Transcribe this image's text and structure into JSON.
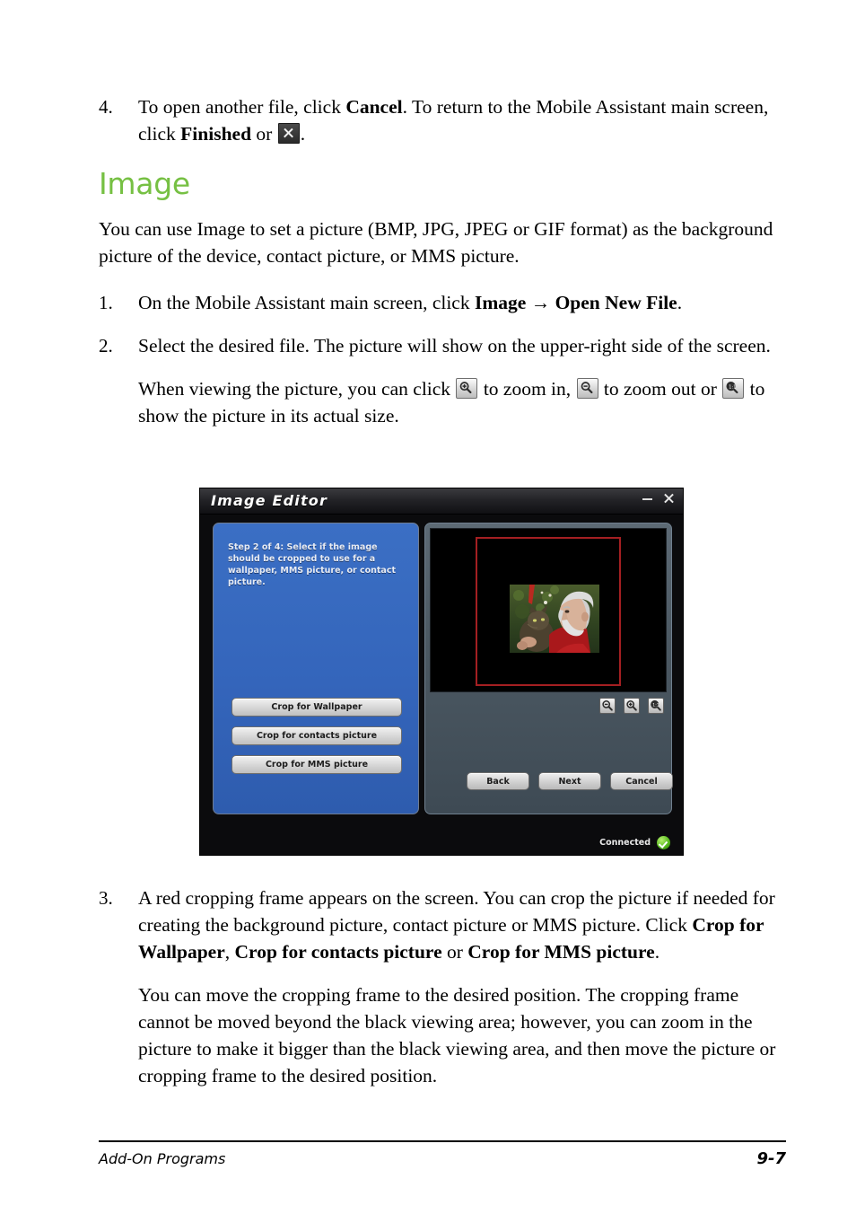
{
  "document": {
    "items": [
      {
        "number": "4.",
        "segments": [
          {
            "text": "To open another file, click ",
            "bold": false
          },
          {
            "text": "Cancel",
            "bold": true
          },
          {
            "text": ". To return to the Mobile Assistant main screen, click ",
            "bold": false
          },
          {
            "text": "Finished",
            "bold": true
          },
          {
            "text": " or ",
            "bold": false
          },
          {
            "icon": "close-icon"
          },
          {
            "text": ".",
            "bold": false
          }
        ]
      }
    ],
    "heading": "Image",
    "intro": "You can use Image to set a picture (BMP, JPG, JPEG or GIF format) as the background picture of the device, contact picture, or MMS picture.",
    "step1_number": "1.",
    "step1_a": "On the Mobile Assistant main screen, click ",
    "step1_b": "Image",
    "step1_arrow": " → ",
    "step1_c": "Open New File",
    "step1_d": ".",
    "step2_number": "2.",
    "step2_text": "Select the desired file. The picture will show on the upper-right side of the screen.",
    "zoom_para_a": "When viewing the picture, you can click ",
    "zoom_para_b": " to zoom in, ",
    "zoom_para_c": " to zoom out or ",
    "zoom_para_d": " to show the picture in its actual size.",
    "step3_number": "3.",
    "step3_a": "A red cropping frame appears on the screen. You can crop the picture if needed for creating the background picture, contact picture or MMS picture. Click ",
    "step3_b": "Crop for Wallpaper",
    "step3_c": ", ",
    "step3_d": "Crop for contacts picture",
    "step3_e": " or ",
    "step3_f": "Crop for MMS picture",
    "step3_g": ".",
    "step3_para2": "You can move the cropping frame to the desired position. The cropping frame cannot be moved beyond the black viewing area; however, you can zoom in the picture to make it bigger than the black viewing area, and then move the picture or cropping frame to the desired position."
  },
  "screenshot": {
    "window_title": "Image Editor",
    "titlebar_buttons": {
      "minimize": "minimize-icon",
      "close": "close-icon"
    },
    "wizard": {
      "step_text": "Step 2 of 4: Select if the image should be cropped to use for a wallpaper, MMS picture, or contact picture.",
      "crop_buttons": [
        "Crop for Wallpaper",
        "Crop for contacts picture",
        "Crop for MMS picture"
      ]
    },
    "preview": {
      "crop_frame_color": "#a41f22",
      "viewer_background": "#000000",
      "zoom_buttons": [
        "zoom-out-icon",
        "zoom-in-icon",
        "actual-size-icon"
      ]
    },
    "nav_buttons": [
      "Back",
      "Next",
      "Cancel"
    ],
    "status": {
      "label": "Connected",
      "indicator": "green-check-icon",
      "indicator_color": "#59bb20"
    }
  },
  "footer": {
    "left": "Add-On Programs",
    "right": "9-7"
  },
  "colors": {
    "heading_green": "#76c043",
    "wizard_blue": "#3465bb",
    "crop_red": "#a41f22"
  }
}
